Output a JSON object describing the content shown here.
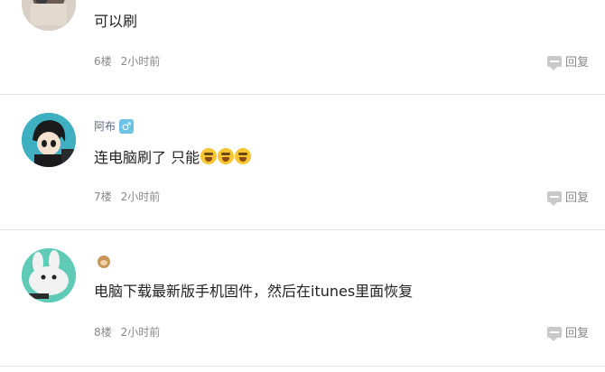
{
  "comments": [
    {
      "username": "",
      "content": "可以刷",
      "floor": "6楼",
      "time": "2小时前",
      "reply_label": "回复"
    },
    {
      "username": "阿布",
      "content": "连电脑刷了 只能",
      "emojis": [
        "laugh-cry-emoji",
        "laugh-cry-emoji",
        "laugh-cry-emoji"
      ],
      "floor": "7楼",
      "time": "2小时前",
      "reply_label": "回复"
    },
    {
      "username": "",
      "content": "电脑下载最新版手机固件，然后在itunes里面恢复",
      "floor": "8楼",
      "time": "2小时前",
      "reply_label": "回复"
    }
  ],
  "colors": {
    "meta": "#888888",
    "username": "#5b6a86",
    "divider": "#e6e6e6"
  }
}
